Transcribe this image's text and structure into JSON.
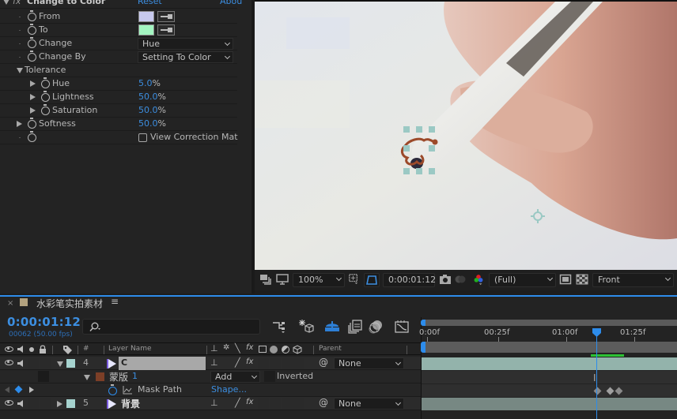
{
  "effect_controls": {
    "effect_name": "Change to Color",
    "fx_glyph": "fx",
    "reset_label": "Reset",
    "about_label": "Abou",
    "properties": [
      {
        "label": "From",
        "kind": "color",
        "color": "#c7c9ee"
      },
      {
        "label": "To",
        "kind": "color",
        "color": "#a3f5c1"
      },
      {
        "label": "Change",
        "kind": "select",
        "value": "Hue"
      },
      {
        "label": "Change By",
        "kind": "select",
        "value": "Setting To Color"
      },
      {
        "label": "Tolerance",
        "kind": "group"
      },
      {
        "label": "Hue",
        "kind": "percent",
        "value": "5.0",
        "unit": "%"
      },
      {
        "label": "Lightness",
        "kind": "percent",
        "value": "50.0",
        "unit": "%"
      },
      {
        "label": "Saturation",
        "kind": "percent",
        "value": "50.0",
        "unit": "%"
      },
      {
        "label": "Softness",
        "kind": "percent",
        "value": "50.0",
        "unit": "%"
      },
      {
        "label": "",
        "kind": "checkbox",
        "value": "View Correction Mat",
        "checked": false
      }
    ]
  },
  "viewer": {
    "zoom": "100%",
    "timecode": "0:00:01:12",
    "resolution": "(Full)",
    "view": "Front",
    "mask_color": "#9c4a2a",
    "handle_color": "#9bc9c4"
  },
  "timeline": {
    "comp_name": "水彩笔实拍素材",
    "comp_color": "#b3a27f",
    "current_time": "0:00:01:12",
    "frame_info": "00062 (50.00 fps)",
    "search_placeholder": "",
    "columns": {
      "number": "#",
      "layer_name": "Layer Name",
      "parent": "Parent"
    },
    "ruler_labels": [
      "0:00f",
      "00:25f",
      "01:00f",
      "01:25f"
    ],
    "playhead_time": "0:00:01:12",
    "layers": [
      {
        "number": "4",
        "name": "C",
        "label_color": "#a6d3cf",
        "blend_parent": "None",
        "selected": true
      },
      {
        "sub": "mask",
        "name": "蒙版",
        "index": "1",
        "mode": "Add",
        "inverted_label": "Inverted",
        "color": "#7c3f27"
      },
      {
        "sub": "property",
        "name": "Mask Path",
        "value": "Shape..."
      },
      {
        "number": "5",
        "name": "背景",
        "label_color": "#a6d3cf",
        "blend_parent": "None",
        "selected": false
      }
    ]
  }
}
